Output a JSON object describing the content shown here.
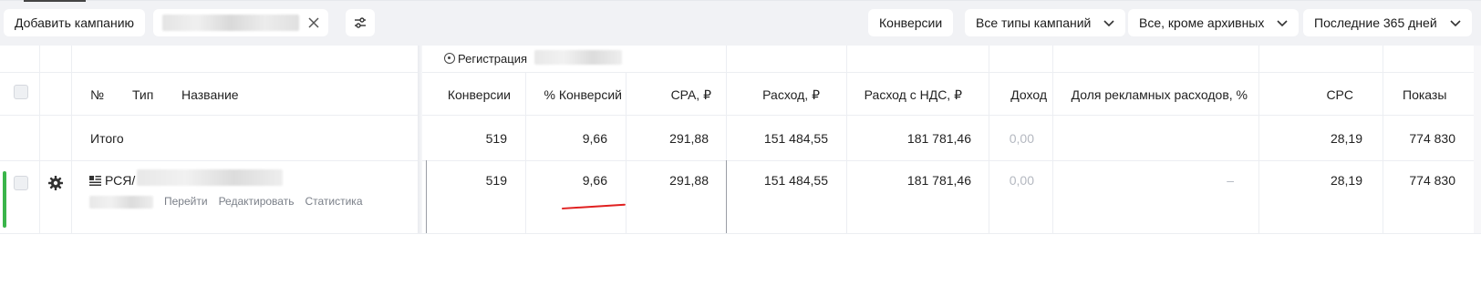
{
  "toolbar": {
    "add_campaign": "Добавить кампанию",
    "conversions": "Конверсии",
    "campaign_types": "Все типы кампаний",
    "status_filter": "Все, кроме архивных",
    "period": "Последние 365 дней"
  },
  "goal": {
    "label": "Регистрация"
  },
  "columns": {
    "num": "№",
    "type": "Тип",
    "name": "Название",
    "conversions": "Конверсии",
    "conv_pct": "% Конверсий",
    "cpa": "CPA, ₽",
    "spend": "Расход, ₽",
    "spend_vat": "Расход с НДС, ₽",
    "income": "Доход",
    "ad_share": "Доля рекламных расходов, %",
    "cpc": "CPC",
    "impressions": "Показы"
  },
  "total": {
    "label": "Итого",
    "conversions": "519",
    "conv_pct": "9,66",
    "cpa": "291,88",
    "spend": "151 484,55",
    "spend_vat": "181 781,46",
    "income": "0,00",
    "cpc": "28,19",
    "impressions": "774 830"
  },
  "rows": [
    {
      "name": "РСЯ/",
      "links": [
        "Перейти",
        "Редактировать",
        "Статистика"
      ],
      "conversions": "519",
      "conv_pct": "9,66",
      "cpa": "291,88",
      "spend": "151 484,55",
      "spend_vat": "181 781,46",
      "income": "0,00",
      "ad_share": "–",
      "cpc": "28,19",
      "impressions": "774 830"
    }
  ],
  "colors": {
    "accent_green": "#3ab54a",
    "annotation_red": "#e02020"
  }
}
